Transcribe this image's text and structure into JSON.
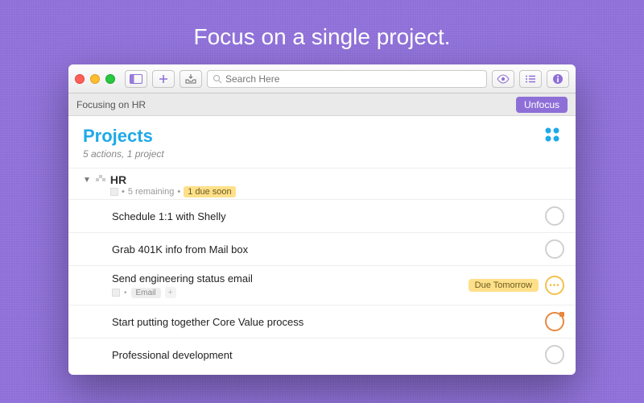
{
  "hero": {
    "title": "Focus on a single project."
  },
  "toolbar": {
    "search_placeholder": "Search Here"
  },
  "focusbar": {
    "text": "Focusing on HR",
    "unfocus_label": "Unfocus"
  },
  "header": {
    "title": "Projects",
    "subtitle": "5 actions, 1 project"
  },
  "project": {
    "name": "HR",
    "meta_remaining": "5 remaining",
    "meta_due": "1 due soon"
  },
  "tasks": [
    {
      "title": "Schedule 1:1 with Shelly",
      "status": "none"
    },
    {
      "title": "Grab 401K info from Mail box",
      "status": "none"
    },
    {
      "title": "Send engineering status email",
      "status": "due",
      "tag": "Email",
      "due_label": "Due Tomorrow"
    },
    {
      "title": "Start putting together Core Value process",
      "status": "flag"
    },
    {
      "title": "Professional development",
      "status": "none"
    }
  ]
}
